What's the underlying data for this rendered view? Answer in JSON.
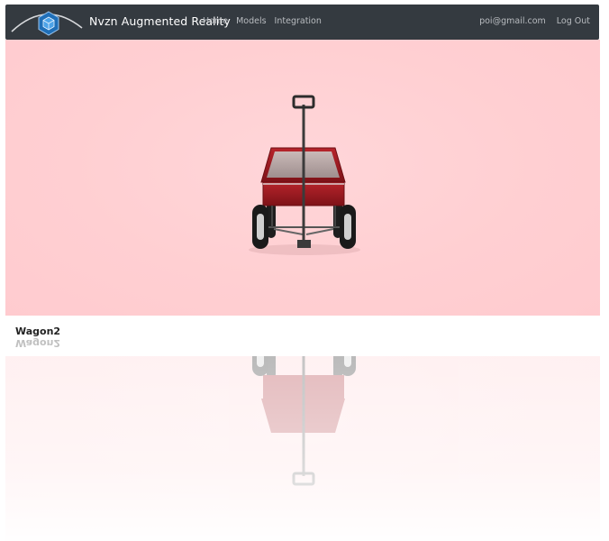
{
  "navbar": {
    "brand_title": "Nvzn Augmented Reality",
    "links": [
      "Home",
      "Models",
      "Integration"
    ],
    "user_email": "poi@gmail.com",
    "logout_label": "Log Out"
  },
  "model": {
    "name": "Wagon2",
    "background_color": "#ffcfd2",
    "wagon_color": "#a51e24"
  }
}
